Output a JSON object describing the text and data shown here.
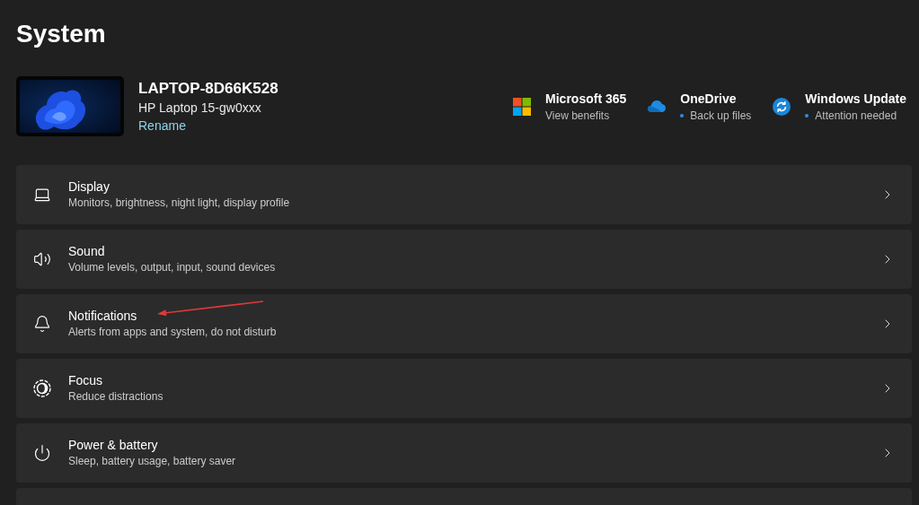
{
  "page": {
    "title": "System"
  },
  "device": {
    "name": "LAPTOP-8D66K528",
    "model": "HP Laptop 15-gw0xxx",
    "rename_link": "Rename"
  },
  "quick_links": [
    {
      "title": "Microsoft 365",
      "subtitle": "View benefits",
      "status_dot": false
    },
    {
      "title": "OneDrive",
      "subtitle": "Back up files",
      "status_dot": true
    },
    {
      "title": "Windows Update",
      "subtitle": "Attention needed",
      "status_dot": true
    }
  ],
  "items": [
    {
      "title": "Display",
      "subtitle": "Monitors, brightness, night light, display profile",
      "pointed_at": false
    },
    {
      "title": "Sound",
      "subtitle": "Volume levels, output, input, sound devices",
      "pointed_at": false
    },
    {
      "title": "Notifications",
      "subtitle": "Alerts from apps and system, do not disturb",
      "pointed_at": true
    },
    {
      "title": "Focus",
      "subtitle": "Reduce distractions",
      "pointed_at": false
    },
    {
      "title": "Power & battery",
      "subtitle": "Sleep, battery usage, battery saver",
      "pointed_at": false
    }
  ],
  "partial_item_visible": true
}
